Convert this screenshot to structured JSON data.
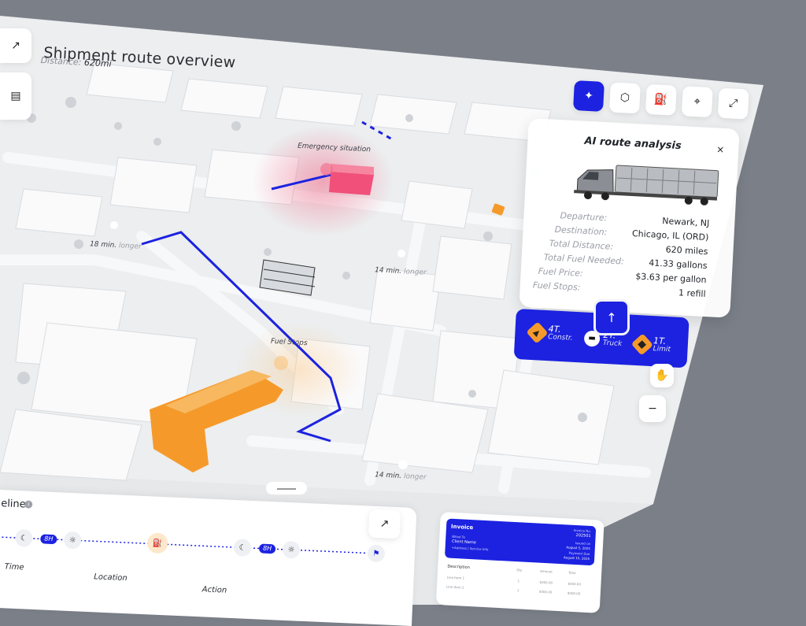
{
  "header": {
    "title": "Shipment route overview",
    "distance_label": "Distance:",
    "distance_value": "620mi"
  },
  "left_rail": {
    "buttons": [
      {
        "icon": "arrow-up-right-icon",
        "glyph": "↗"
      },
      {
        "icon": "calendar-icon",
        "glyph": "▤"
      }
    ]
  },
  "toolbar": {
    "buttons": [
      {
        "name": "ai-magic-button",
        "icon": "magic-wand-icon",
        "glyph": "✦",
        "active": true
      },
      {
        "name": "package-button",
        "icon": "box-icon",
        "glyph": "⬡",
        "active": false
      },
      {
        "name": "fuel-button",
        "icon": "fuel-pump-icon",
        "glyph": "⛽",
        "active": false
      },
      {
        "name": "location-button",
        "icon": "map-pin-icon",
        "glyph": "⌖",
        "active": false
      },
      {
        "name": "fullscreen-button",
        "icon": "expand-icon",
        "glyph": "⤢",
        "active": false
      }
    ]
  },
  "ai_card": {
    "title": "AI route analysis",
    "close_glyph": "×",
    "rows": [
      {
        "label": "Departure:",
        "value": "Newark, NJ"
      },
      {
        "label": "Destination:",
        "value": "Chicago, IL (ORD)"
      },
      {
        "label": "Total Distance:",
        "value": "620 miles"
      },
      {
        "label": "Total Fuel Needed:",
        "value": "41.33 gallons"
      },
      {
        "label": "Fuel Price:",
        "value": "$3.63 per gallon"
      },
      {
        "label": "Fuel Stops:",
        "value": "1 refill"
      }
    ]
  },
  "summary_bar": {
    "up_glyph": "↑",
    "stats": [
      {
        "num": "4T.",
        "cap": "Constr.",
        "icon": "construction-icon"
      },
      {
        "num": "2T.",
        "cap": "Truck",
        "icon": "truck-icon"
      },
      {
        "num": "1T.",
        "cap": "Limit",
        "icon": "speed-limit-icon"
      }
    ]
  },
  "map_labels": {
    "emergency": "Emergency situation",
    "fuel_stops": "Fuel Stops",
    "delay_a_min": "18 min.",
    "delay_a_word": "longer",
    "delay_b_min": "14 min.",
    "delay_b_word": "longer",
    "delay_c_min": "14 min.",
    "delay_c_word": "longer"
  },
  "zoom": {
    "out_glyph": "−",
    "hand_glyph": "✋"
  },
  "timeline": {
    "title": "eline",
    "info_glyph": "i",
    "pill_a": "8H",
    "pill_b": "8H",
    "expand_glyph": "↗",
    "columns": [
      "Time",
      "Location",
      "Action"
    ]
  },
  "invoice": {
    "title": "Invoice",
    "invoice_no_label": "Invoice No.",
    "invoice_no": "202501",
    "billed_to": "Billed To",
    "client": "Client Name",
    "client_sub": "+Address | Service Info",
    "issued_on": "Issued on",
    "issued_date": "August 5, 2025",
    "due_label": "Payment Due",
    "due_date": "August 15, 2025",
    "cols": [
      "Description",
      "Qty",
      "Amount",
      "Total"
    ],
    "rows": [
      {
        "desc": "Line Item 1",
        "qty": "1",
        "amount": "$000.00",
        "total": "$000.00"
      },
      {
        "desc": "Line Item 2",
        "qty": "1",
        "amount": "$000.00",
        "total": "$000.00"
      }
    ]
  },
  "colors": {
    "accent": "#1c22e0",
    "emergency": "#f0507a",
    "highlight": "#f59a2a",
    "background": "#7b7f88"
  }
}
